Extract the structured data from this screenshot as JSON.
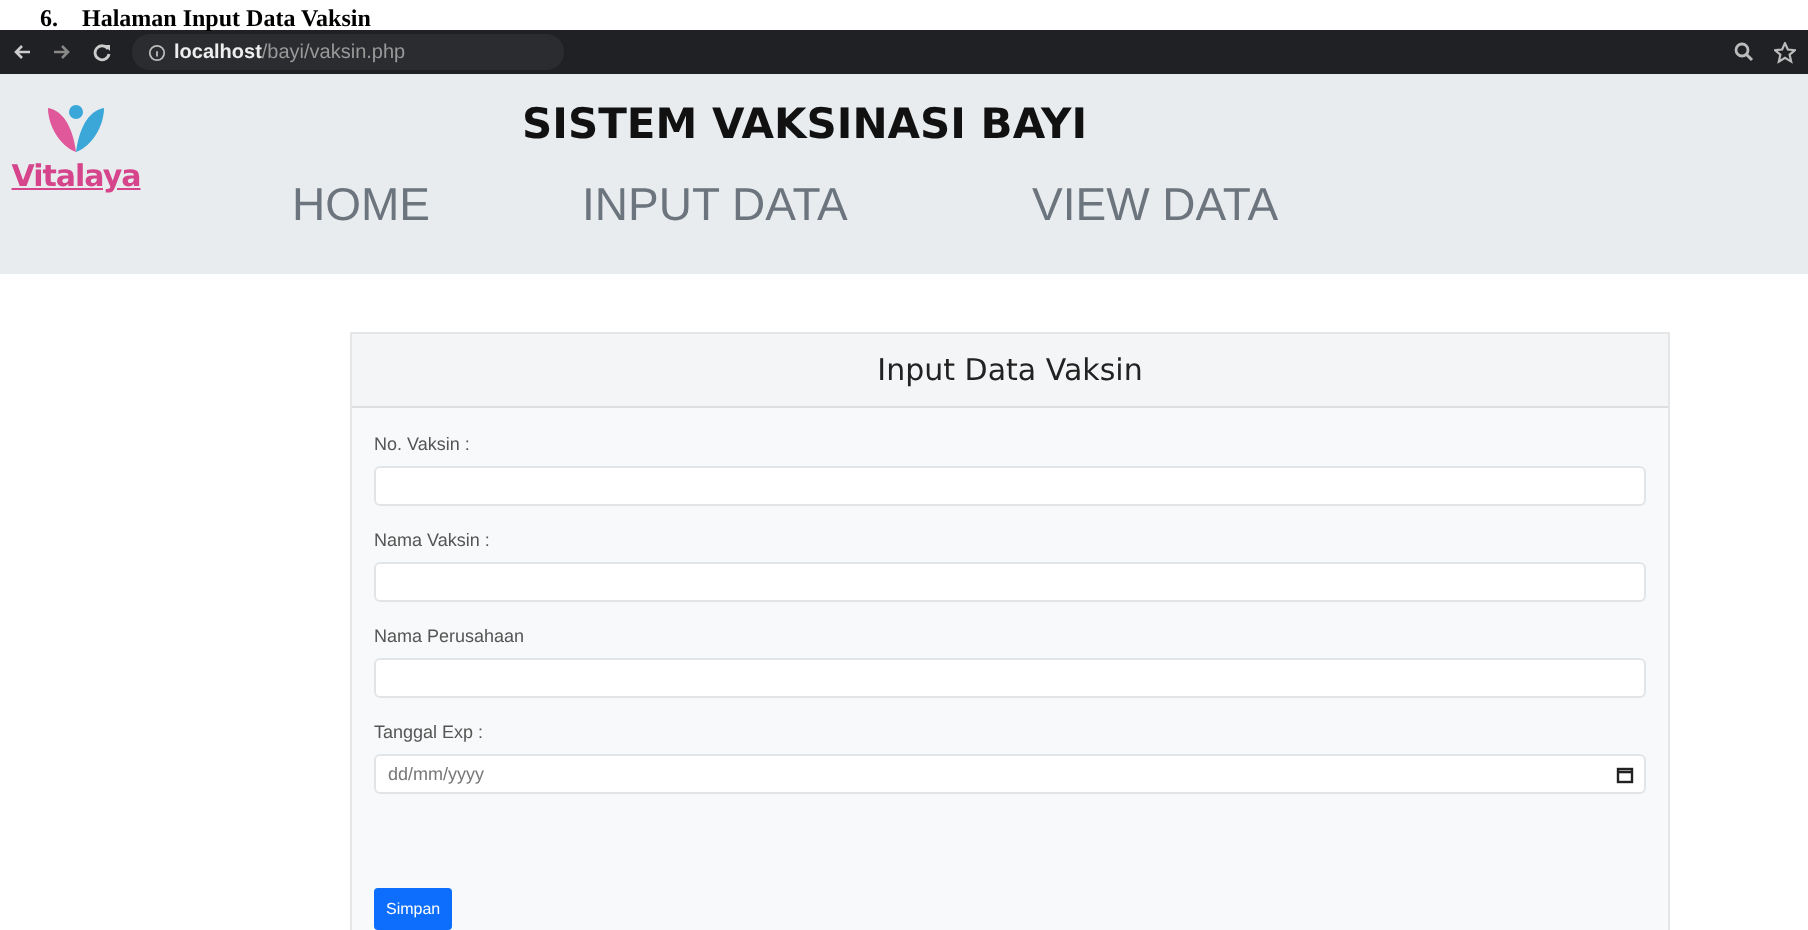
{
  "caption": "6.    Halaman Input Data Vaksin",
  "browser": {
    "url_host": "localhost",
    "url_path": "/bayi/vaksin.php"
  },
  "header": {
    "logo_text": "Vitalaya",
    "title": "SISTEM VAKSINASI BAYI",
    "nav": [
      {
        "label": "HOME"
      },
      {
        "label": "INPUT DATA"
      },
      {
        "label": "VIEW DATA"
      }
    ]
  },
  "form": {
    "title": "Input Data Vaksin",
    "fields": [
      {
        "label": "No. Vaksin :",
        "kind": "text"
      },
      {
        "label": "Nama Vaksin :",
        "kind": "text"
      },
      {
        "label": "Nama Perusahaan",
        "kind": "text"
      },
      {
        "label": "Tanggal Exp :",
        "kind": "date",
        "placeholder": "dd/mm/yyyy"
      }
    ],
    "submit": "Simpan"
  }
}
